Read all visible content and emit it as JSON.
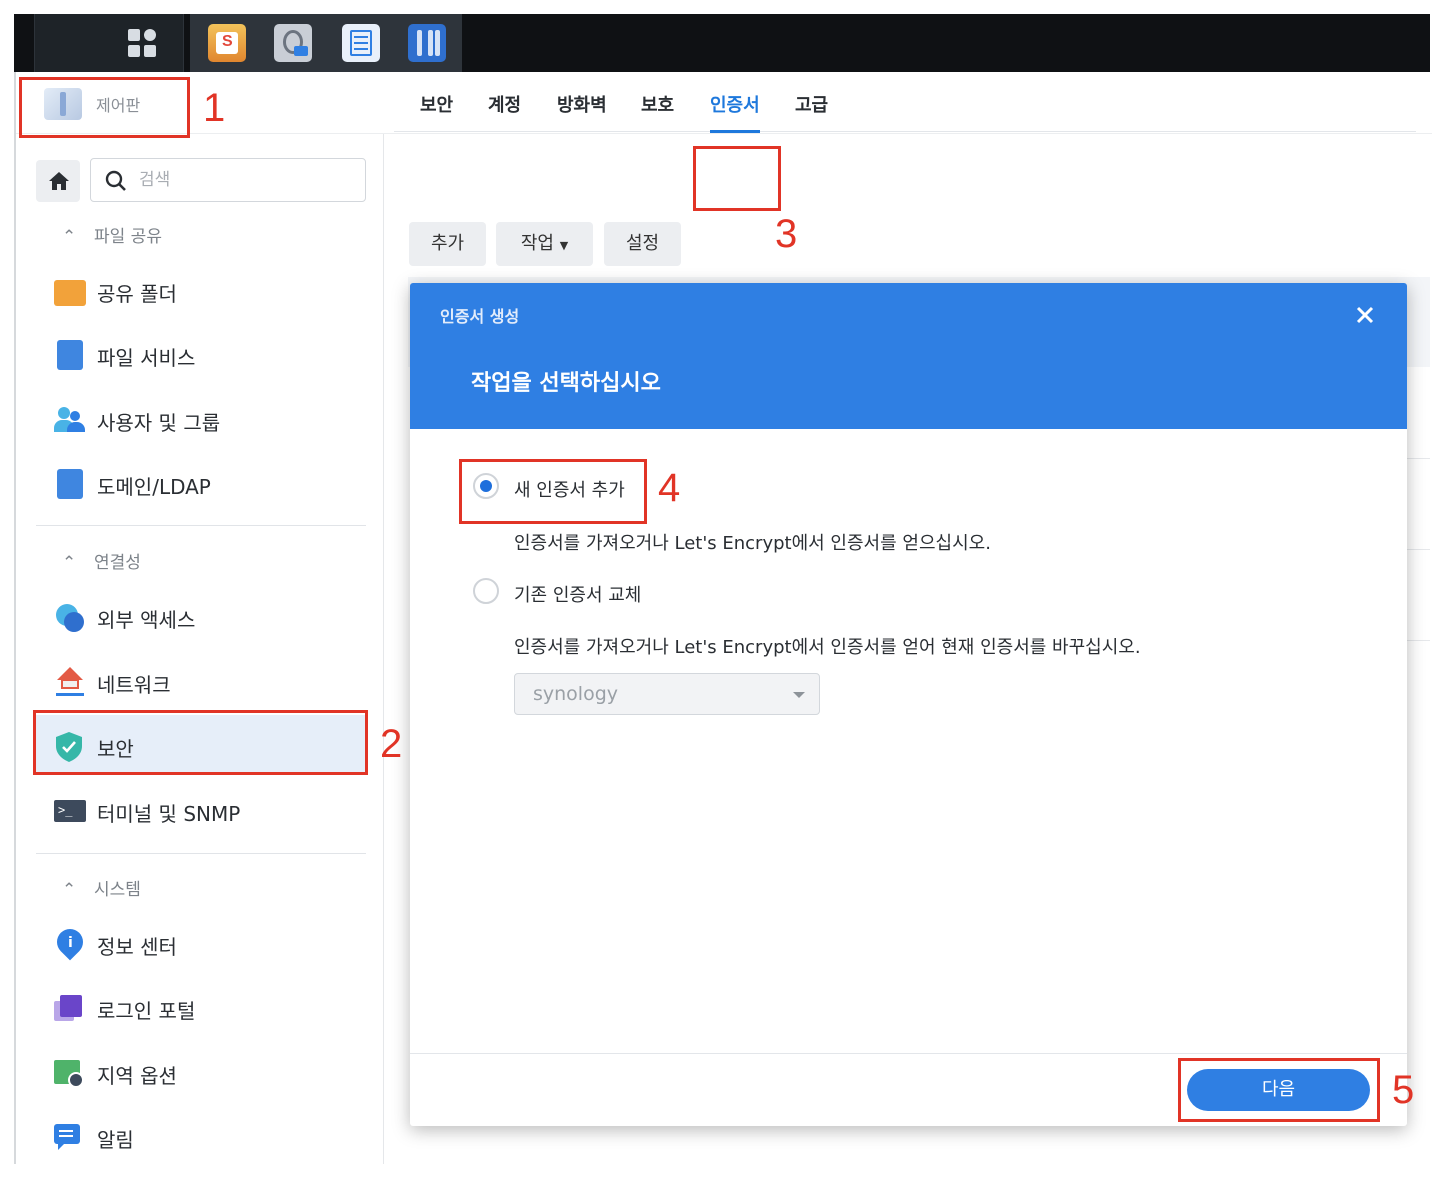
{
  "window": {
    "title": "제어판"
  },
  "search": {
    "placeholder": "검색"
  },
  "sidebar": {
    "sections": [
      {
        "label": "파일 공유",
        "items": [
          "공유 폴더",
          "파일 서비스",
          "사용자 및 그룹",
          "도메인/LDAP"
        ]
      },
      {
        "label": "연결성",
        "items": [
          "외부 액세스",
          "네트워크",
          "보안",
          "터미널 및 SNMP"
        ]
      },
      {
        "label": "시스템",
        "items": [
          "정보 센터",
          "로그인 포털",
          "지역 옵션",
          "알림"
        ]
      }
    ],
    "active_item": "보안"
  },
  "tabs": [
    "보안",
    "계정",
    "방화벽",
    "보호",
    "인증서",
    "고급"
  ],
  "active_tab": "인증서",
  "toolbar": {
    "add": "추가",
    "action": "작업",
    "settings": "설정"
  },
  "dialog": {
    "title": "인증서 생성",
    "heading": "작업을 선택하십시오",
    "option_new": "새 인증서 추가",
    "option_new_desc": "인증서를 가져오거나 Let's Encrypt에서 인증서를 얻으십시오.",
    "option_replace": "기존 인증서 교체",
    "option_replace_desc": "인증서를 가져오거나 Let's Encrypt에서 인증서를 얻어 현재 인증서를 바꾸십시오.",
    "select_value": "synology",
    "next_button": "다음",
    "selected_option": "option_new"
  },
  "annotations": [
    "1",
    "2",
    "3",
    "4",
    "5"
  ],
  "colors": {
    "accent": "#2f7fe3",
    "annotation": "#e13426",
    "taskbar": "#0f1114"
  }
}
